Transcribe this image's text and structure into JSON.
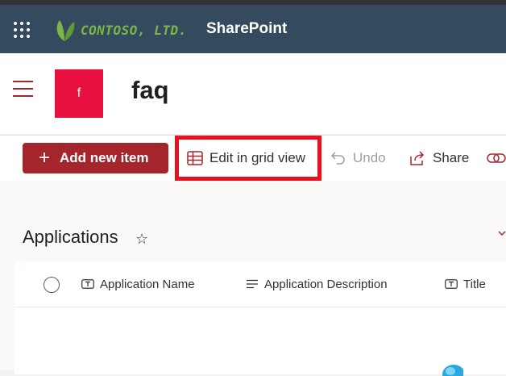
{
  "suitebar": {
    "logo_text": "CONTOSO, LTD.",
    "app_name": "SharePoint",
    "bg_color": "#344a5e",
    "logo_color": "#7ab648"
  },
  "site": {
    "logo_letter": "f",
    "title": "faq",
    "accent": "#a4262c",
    "logo_color": "#e8103e"
  },
  "commandbar": {
    "add_new_item": "Add new item",
    "edit_grid": "Edit in grid view",
    "undo": "Undo",
    "share": "Share"
  },
  "list": {
    "title": "Applications",
    "columns": [
      {
        "label": "Application Name",
        "icon": "text-column-icon"
      },
      {
        "label": "Application Description",
        "icon": "multiline-text-icon"
      },
      {
        "label": "Title",
        "icon": "text-column-icon"
      }
    ]
  }
}
